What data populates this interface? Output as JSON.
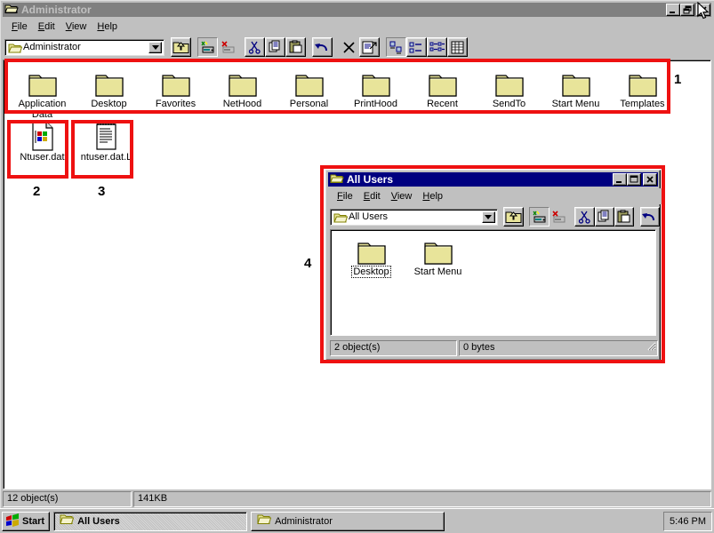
{
  "main_window": {
    "title": "Administrator",
    "title_icon": "folder-open-icon",
    "active": false,
    "window_buttons": {
      "minimize": "_",
      "restore": "restore",
      "close": "X"
    },
    "menu": [
      {
        "label": "File",
        "accel": "F"
      },
      {
        "label": "Edit",
        "accel": "E"
      },
      {
        "label": "View",
        "accel": "V"
      },
      {
        "label": "Help",
        "accel": "H"
      }
    ],
    "address_bar": {
      "value": "Administrator",
      "icon": "folder-open-icon"
    },
    "toolbar_buttons": [
      {
        "name": "up-one-level-icon",
        "tip": "Up One Level"
      },
      {
        "name": "map-network-drive-icon",
        "tip": "Map Network Drive"
      },
      {
        "name": "disconnect-network-drive-icon",
        "tip": "Disconnect Net Drive"
      },
      {
        "name": "cut-icon",
        "tip": "Cut"
      },
      {
        "name": "copy-icon",
        "tip": "Copy"
      },
      {
        "name": "paste-icon",
        "tip": "Paste"
      },
      {
        "name": "undo-icon",
        "tip": "Undo"
      },
      {
        "name": "delete-icon",
        "tip": "Delete"
      },
      {
        "name": "properties-icon",
        "tip": "Properties"
      },
      {
        "name": "large-icons-icon",
        "tip": "Large Icons"
      },
      {
        "name": "small-icons-icon",
        "tip": "Small Icons"
      },
      {
        "name": "list-view-icon",
        "tip": "List"
      },
      {
        "name": "details-view-icon",
        "tip": "Details"
      }
    ],
    "folders": [
      {
        "label": "Application Data",
        "icon": "folder-icon"
      },
      {
        "label": "Desktop",
        "icon": "folder-icon"
      },
      {
        "label": "Favorites",
        "icon": "folder-icon"
      },
      {
        "label": "NetHood",
        "icon": "folder-icon"
      },
      {
        "label": "Personal",
        "icon": "folder-icon"
      },
      {
        "label": "PrintHood",
        "icon": "folder-icon"
      },
      {
        "label": "Recent",
        "icon": "folder-icon"
      },
      {
        "label": "SendTo",
        "icon": "folder-icon"
      },
      {
        "label": "Start Menu",
        "icon": "folder-icon"
      },
      {
        "label": "Templates",
        "icon": "folder-icon"
      }
    ],
    "files": [
      {
        "label": "Ntuser.dat",
        "icon": "registry-file-icon"
      },
      {
        "label": "ntuser.dat.L",
        "icon": "text-file-icon"
      }
    ],
    "status": {
      "objects": "12 object(s)",
      "size": "141KB"
    }
  },
  "allusers_window": {
    "title": "All Users",
    "title_icon": "folder-open-icon",
    "active": true,
    "window_buttons": {
      "minimize": "_",
      "maximize": "maximize",
      "close": "X"
    },
    "menu": [
      {
        "label": "File",
        "accel": "F"
      },
      {
        "label": "Edit",
        "accel": "E"
      },
      {
        "label": "View",
        "accel": "V"
      },
      {
        "label": "Help",
        "accel": "H"
      }
    ],
    "address_bar": {
      "value": "All Users",
      "icon": "folder-open-icon"
    },
    "toolbar_buttons": [
      {
        "name": "up-one-level-icon",
        "tip": "Up One Level"
      },
      {
        "name": "map-network-drive-icon",
        "tip": "Map Network Drive"
      },
      {
        "name": "disconnect-network-drive-icon",
        "tip": "Disconnect Net Drive"
      },
      {
        "name": "cut-icon",
        "tip": "Cut"
      },
      {
        "name": "copy-icon",
        "tip": "Copy"
      },
      {
        "name": "paste-icon",
        "tip": "Paste"
      },
      {
        "name": "undo-icon",
        "tip": "Undo"
      }
    ],
    "folders": [
      {
        "label": "Desktop",
        "icon": "folder-icon",
        "focused": true
      },
      {
        "label": "Start Menu",
        "icon": "folder-icon",
        "focused": false
      }
    ],
    "status": {
      "objects": "2 object(s)",
      "size": "0 bytes"
    }
  },
  "annotations": [
    {
      "number": "1",
      "target": "folders-row"
    },
    {
      "number": "2",
      "target": "ntuser-dat-file"
    },
    {
      "number": "3",
      "target": "ntuser-dat-log-file"
    },
    {
      "number": "4",
      "target": "all-users-window"
    }
  ],
  "annotation_color": "#ee1111",
  "taskbar": {
    "start_label": "Start",
    "start_icon": "windows-flag-icon",
    "buttons": [
      {
        "label": "All Users",
        "icon": "folder-open-icon",
        "active": true
      },
      {
        "label": "Administrator",
        "icon": "folder-open-icon",
        "active": false
      }
    ],
    "clock": "5:46 PM"
  },
  "colors": {
    "face": "#c0c0c0",
    "active_title": "#000080",
    "inactive_title": "#808080",
    "folder_yellow": "#e8e49a",
    "annotation_red": "#ee1111",
    "desktop": "#ffffff"
  }
}
